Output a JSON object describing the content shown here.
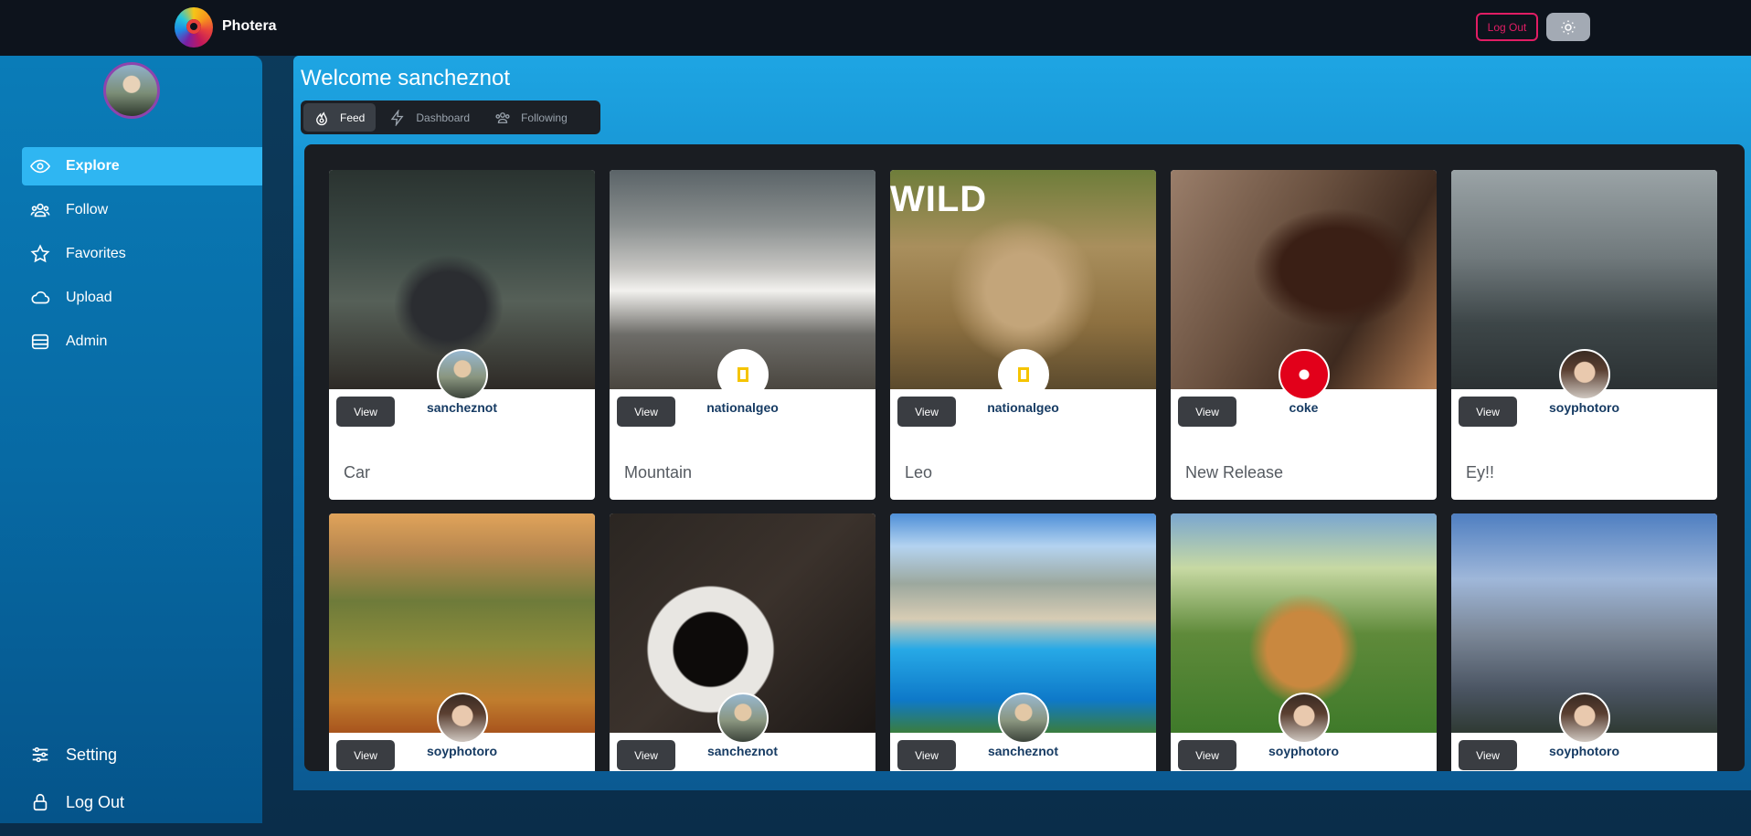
{
  "app": {
    "name": "Photera"
  },
  "header": {
    "logout_label": "Log Out",
    "theme_icon": "sun-icon"
  },
  "sidebar": {
    "items": [
      {
        "label": "Explore",
        "icon": "eye-icon",
        "active": true
      },
      {
        "label": "Follow",
        "icon": "users-icon"
      },
      {
        "label": "Favorites",
        "icon": "star-icon"
      },
      {
        "label": "Upload",
        "icon": "cloud-icon"
      },
      {
        "label": "Admin",
        "icon": "database-icon"
      }
    ],
    "bottom": [
      {
        "label": "Setting",
        "icon": "sliders-icon"
      },
      {
        "label": "Log Out",
        "icon": "lock-icon"
      }
    ]
  },
  "main": {
    "welcome": "Welcome sancheznot",
    "tabs": [
      {
        "label": "Feed",
        "icon": "flame-icon",
        "active": true
      },
      {
        "label": "Dashboard",
        "icon": "bolt-icon"
      },
      {
        "label": "Following",
        "icon": "users-icon"
      }
    ]
  },
  "cards": [
    {
      "user": "sancheznot",
      "title": "Car",
      "view": "View"
    },
    {
      "user": "nationalgeo",
      "title": "Mountain",
      "view": "View"
    },
    {
      "user": "nationalgeo",
      "title": "Leo",
      "view": "View",
      "overlay_text": "WILD"
    },
    {
      "user": "coke",
      "title": "New Release",
      "view": "View"
    },
    {
      "user": "soyphotoro",
      "title": "Ey!!",
      "view": "View"
    },
    {
      "user": "soyphotoro",
      "title": "",
      "view": "View"
    },
    {
      "user": "sancheznot",
      "title": "",
      "view": "View"
    },
    {
      "user": "sancheznot",
      "title": "",
      "view": "View"
    },
    {
      "user": "soyphotoro",
      "title": "",
      "view": "View"
    },
    {
      "user": "soyphotoro",
      "title": "",
      "view": "View"
    }
  ]
}
